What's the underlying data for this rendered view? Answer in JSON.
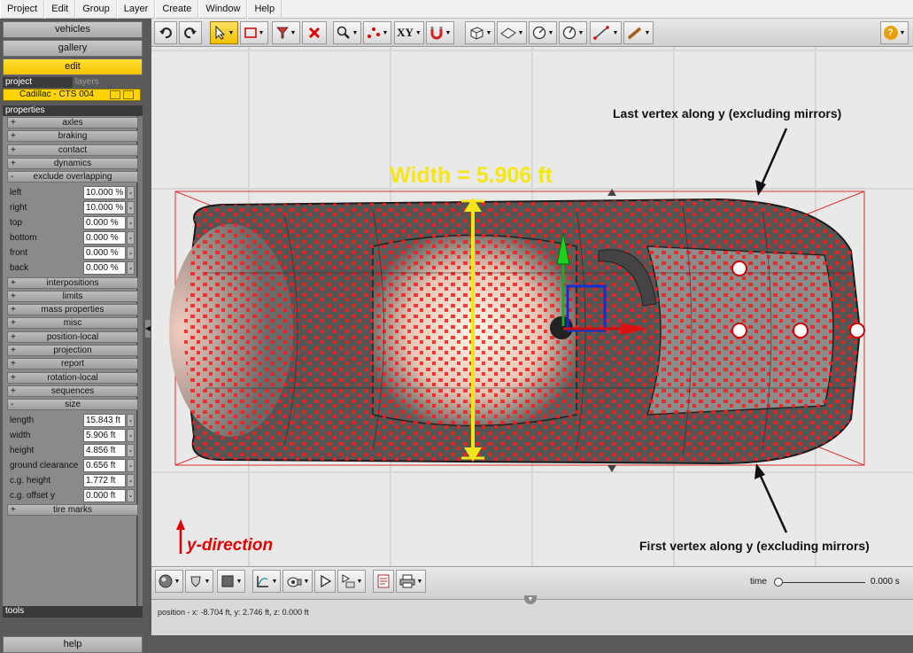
{
  "menu": [
    "Project",
    "Edit",
    "Group",
    "Layer",
    "Create",
    "Window",
    "Help"
  ],
  "left_panel": {
    "buttons": [
      "vehicles",
      "gallery",
      "edit"
    ],
    "tabs": [
      "project",
      "layers"
    ],
    "project_name": "Cadillac - CTS 004",
    "properties_header": "properties",
    "sections_top": [
      "axles",
      "braking",
      "contact",
      "dynamics",
      "exclude overlapping"
    ],
    "exclude_overlapping": [
      {
        "label": "left",
        "value": "10.000 %"
      },
      {
        "label": "right",
        "value": "10.000 %"
      },
      {
        "label": "top",
        "value": "0.000 %"
      },
      {
        "label": "bottom",
        "value": "0.000 %"
      },
      {
        "label": "front",
        "value": "0.000 %"
      },
      {
        "label": "back",
        "value": "0.000 %"
      }
    ],
    "sections_mid": [
      "interpositions",
      "limits",
      "mass properties",
      "misc",
      "position-local",
      "projection",
      "report",
      "rotation-local",
      "sequences",
      "size"
    ],
    "size": [
      {
        "label": "length",
        "value": "15.843 ft"
      },
      {
        "label": "width",
        "value": "5.906 ft"
      },
      {
        "label": "height",
        "value": "4.856 ft"
      },
      {
        "label": "ground clearance",
        "value": "0.656 ft"
      },
      {
        "label": "c.g. height",
        "value": "1.772 ft"
      },
      {
        "label": "c.g. offset y",
        "value": "0.000 ft"
      }
    ],
    "sections_bottom": [
      "tire marks"
    ],
    "tools_header": "tools",
    "help_button": "help"
  },
  "toolbar": {
    "xy_label": "XY",
    "help_glyph": "?"
  },
  "viewport": {
    "width_annotation": "Width = 5.906 ft",
    "last_vertex_label": "Last vertex along y (excluding mirrors)",
    "first_vertex_label": "First vertex along y (excluding mirrors)",
    "y_direction_label": "y-direction",
    "colors": {
      "annotation_yellow": "#f5e61a",
      "vertex_red": "#ff0000",
      "label_red": "#e00000"
    }
  },
  "bottombar": {
    "time_label": "time",
    "time_value": "0.000 s"
  },
  "status": {
    "position_text": "position - x: -8.704 ft, y: 2.746 ft, z: 0.000 ft"
  }
}
